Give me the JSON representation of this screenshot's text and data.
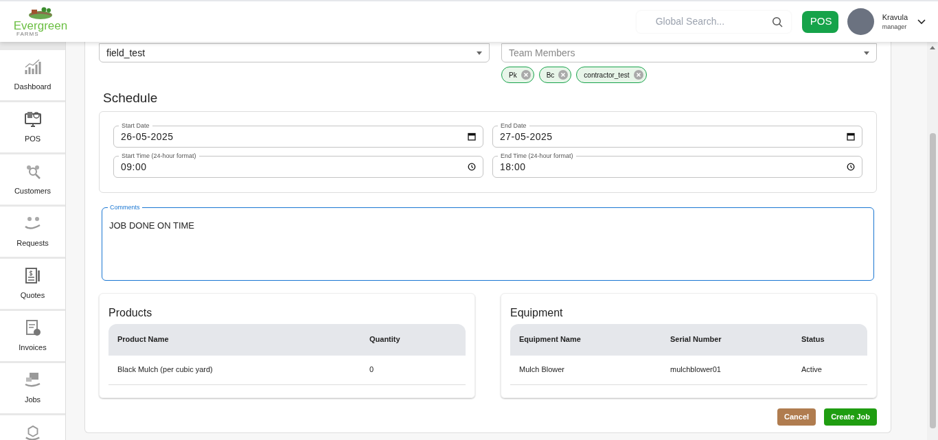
{
  "header": {
    "logo_text": "Evergreen",
    "logo_subtext": "FARMS",
    "search": {
      "placeholder": "Global Search..."
    },
    "pos_button": "POS",
    "user": {
      "name": "Kravula",
      "role": "manager"
    }
  },
  "sidebar": {
    "items": [
      {
        "label": "Dashboard"
      },
      {
        "label": "POS"
      },
      {
        "label": "Customers"
      },
      {
        "label": "Requests"
      },
      {
        "label": "Quotes"
      },
      {
        "label": "Invoices"
      },
      {
        "label": "Jobs"
      }
    ]
  },
  "form": {
    "field": {
      "value": "field_test"
    },
    "team_members": {
      "placeholder": "Team Members",
      "chips": [
        "Pk",
        "Bc",
        "contractor_test"
      ]
    },
    "schedule": {
      "title": "Schedule",
      "fields": [
        {
          "label": "Start Date",
          "value": "26-05-2025",
          "kind": "date"
        },
        {
          "label": "End Date",
          "value": "27-05-2025",
          "kind": "date"
        },
        {
          "label": "Start Time (24-hour format)",
          "value": "09:00",
          "kind": "time"
        },
        {
          "label": "End Time (24-hour format)",
          "value": "18:00",
          "kind": "time"
        }
      ]
    },
    "comments": {
      "label": "Comments",
      "value": "JOB DONE ON TIME"
    },
    "products": {
      "title": "Products",
      "columns": [
        "Product Name",
        "Quantity"
      ],
      "rows": [
        [
          "Black Mulch (per cubic yard)",
          "0"
        ]
      ]
    },
    "equipment": {
      "title": "Equipment",
      "columns": [
        "Equipment Name",
        "Serial Number",
        "Status"
      ],
      "rows": [
        [
          "Mulch Blower",
          "mulchblower01",
          "Active"
        ]
      ]
    },
    "buttons": [
      {
        "label": "Cancel",
        "kind": "secondary"
      },
      {
        "label": "Create Job",
        "kind": "primary"
      }
    ]
  }
}
